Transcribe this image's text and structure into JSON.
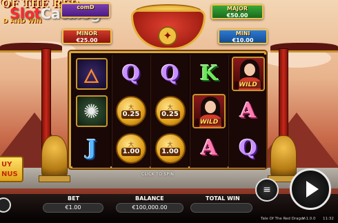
{
  "logo": {
    "title": "OF THE RED",
    "subtitle": "D AND WIN"
  },
  "watermark": {
    "part1": "Slot",
    "part2": "Catalog"
  },
  "jackpots": {
    "grand": {
      "name": "comD",
      "value": ""
    },
    "minor": {
      "name": "MINOR",
      "value": "€25.00"
    },
    "major": {
      "name": "MAJOR",
      "value": "€50.00"
    },
    "mini": {
      "name": "MINI",
      "value": "€10.00"
    }
  },
  "reels": [
    [
      {
        "type": "phoenix",
        "label": ""
      },
      {
        "type": "tiger",
        "label": ""
      },
      {
        "type": "letter",
        "label": "J",
        "color": "blue"
      }
    ],
    [
      {
        "type": "letter",
        "label": "Q",
        "color": "purple"
      },
      {
        "type": "coin",
        "label": "0.25"
      },
      {
        "type": "coin",
        "label": "1.00"
      }
    ],
    [
      {
        "type": "letter",
        "label": "Q",
        "color": "purple"
      },
      {
        "type": "coin",
        "label": "0.25"
      },
      {
        "type": "coin",
        "label": "1.00"
      }
    ],
    [
      {
        "type": "letter",
        "label": "K",
        "color": "green"
      },
      {
        "type": "wild",
        "label": "WILD"
      },
      {
        "type": "letter",
        "label": "A",
        "color": "pink"
      }
    ],
    [
      {
        "type": "wild",
        "label": "WILD"
      },
      {
        "type": "letter",
        "label": "A",
        "color": "pink"
      },
      {
        "type": "letter",
        "label": "Q",
        "color": "purple"
      }
    ]
  ],
  "coin_glyph": "大",
  "click_to_spin": "CLICK TO SPIN",
  "buy_bonus": {
    "line1": "UY",
    "line2": "NUS"
  },
  "stats": {
    "bet_label": "BET",
    "bet_value": "€1.00",
    "balance_label": "BALANCE",
    "balance_value": "€100,000.00",
    "win_label": "TOTAL WIN",
    "win_value": ""
  },
  "footer": {
    "game_name": "Tale Of The Red Dragon",
    "version": "V 1.0.0",
    "clock": "11:32"
  },
  "icons": {
    "stake": "coin-stack-icon",
    "spin": "play-icon",
    "sound": "speaker-icon"
  }
}
